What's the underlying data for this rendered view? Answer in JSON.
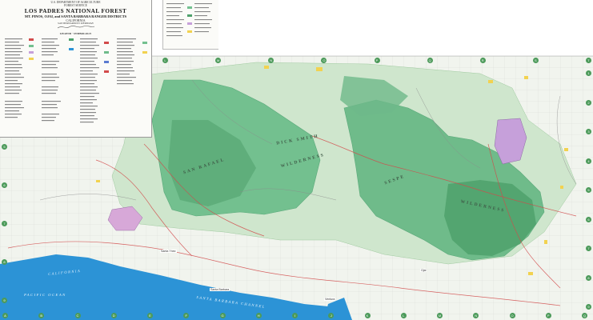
{
  "map": {
    "colors": {
      "forest": "#73c08f",
      "forest_dark": "#5aa97a",
      "wilderness": "#4fa16b",
      "land": "#e9f1e6",
      "ocean": "#2c93d6",
      "private": "#c9a0d8",
      "yellow_parcels": "#f2d250",
      "roads": "#d24a4a",
      "grid": "#b9b9b9"
    },
    "heading": {
      "agency_line1": "U.S. DEPARTMENT OF AGRICULTURE",
      "agency_line2": "FOREST SERVICE",
      "title": "LOS PADRES NATIONAL FOREST",
      "subtitle": "MT. PINOS, OJAI, and SANTA BARBARA RANGER DISTRICTS",
      "state": "CALIFORNIA",
      "meridian": "SAN BERNARDINO MERIDIAN"
    },
    "legend_heading": "LEGEND · SYMBOLOGY",
    "labels": {
      "wilderness_center": "WILDERNESS",
      "wilderness_east": "WILDERNESS",
      "san_rafael": "SAN RAFAEL",
      "dick_smith": "DICK SMITH",
      "sespe": "SESPE",
      "pacific_ocean": "PACIFIC OCEAN",
      "santa_barbara_channel": "SANTA BARBARA CHANNEL",
      "california": "CALIFORNIA"
    },
    "grid_letters": [
      "A",
      "B",
      "C",
      "D",
      "E",
      "F",
      "G",
      "H",
      "I",
      "J",
      "K",
      "L",
      "M",
      "N",
      "O",
      "P",
      "Q",
      "R",
      "S",
      "T"
    ],
    "side_numbers": [
      "1",
      "2",
      "3",
      "4",
      "5",
      "6",
      "7",
      "8",
      "9"
    ],
    "places": [
      "Santa Barbara",
      "Ventura",
      "Ojai",
      "Santa Ynez"
    ]
  }
}
